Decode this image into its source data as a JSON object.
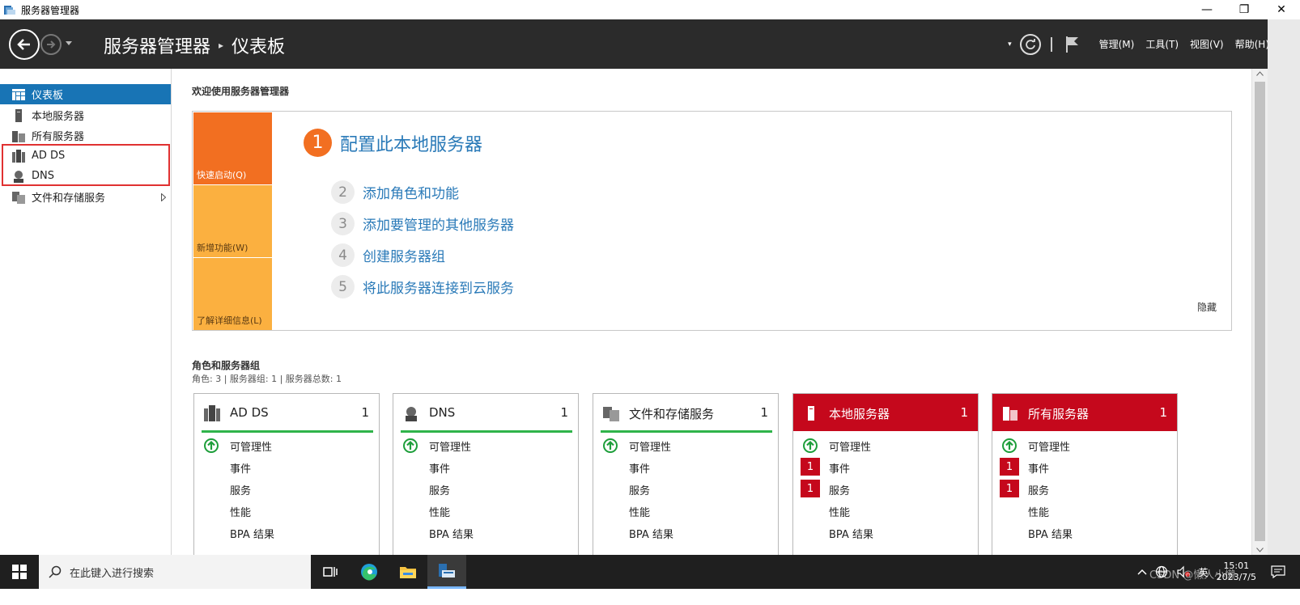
{
  "window": {
    "title": "服务器管理器",
    "minimize": "—",
    "maximize": "❐",
    "close": "✕"
  },
  "header": {
    "breadcrumb_root": "服务器管理器",
    "breadcrumb_sep": "▸",
    "breadcrumb_page": "仪表板",
    "dropdown": "▾",
    "menus": [
      "管理(M)",
      "工具(T)",
      "视图(V)",
      "帮助(H)"
    ]
  },
  "sidebar": {
    "items": [
      {
        "label": "仪表板",
        "icon": "dashboard-icon",
        "active": true
      },
      {
        "label": "本地服务器",
        "icon": "server-icon"
      },
      {
        "label": "所有服务器",
        "icon": "servers-icon"
      },
      {
        "label": "AD DS",
        "icon": "adds-icon"
      },
      {
        "label": "DNS",
        "icon": "dns-icon"
      },
      {
        "label": "文件和存储服务",
        "icon": "file-storage-icon"
      }
    ]
  },
  "quickstart": {
    "welcome": "欢迎使用服务器管理器",
    "tabs": [
      "快速启动(Q)",
      "新增功能(W)",
      "了解详细信息(L)"
    ],
    "step1": {
      "num": "1",
      "label": "配置此本地服务器"
    },
    "steps": [
      {
        "num": "2",
        "label": "添加角色和功能"
      },
      {
        "num": "3",
        "label": "添加要管理的其他服务器"
      },
      {
        "num": "4",
        "label": "创建服务器组"
      },
      {
        "num": "5",
        "label": "将此服务器连接到云服务"
      }
    ],
    "hide": "隐藏"
  },
  "roles": {
    "title": "角色和服务器组",
    "subtitle": "角色: 3 | 服务器组: 1 | 服务器总数: 1",
    "rows": [
      "可管理性",
      "事件",
      "服务",
      "性能",
      "BPA 结果"
    ],
    "tiles": [
      {
        "name": "AD DS",
        "count": "1",
        "alert": false,
        "events_badge": "",
        "services_badge": ""
      },
      {
        "name": "DNS",
        "count": "1",
        "alert": false,
        "events_badge": "",
        "services_badge": ""
      },
      {
        "name": "文件和存储服务",
        "count": "1",
        "alert": false,
        "events_badge": "",
        "services_badge": ""
      },
      {
        "name": "本地服务器",
        "count": "1",
        "alert": true,
        "events_badge": "1",
        "services_badge": "1"
      },
      {
        "name": "所有服务器",
        "count": "1",
        "alert": true,
        "events_badge": "1",
        "services_badge": "1"
      }
    ]
  },
  "taskbar": {
    "search_placeholder": "在此键入进行搜索",
    "ime": "英",
    "time": "15:01",
    "date": "2023/7/5",
    "watermark": "CSDN @懒人小懒"
  },
  "colors": {
    "accent": "#1874b5",
    "orange": "#f26f21",
    "amber": "#fbb040",
    "alert_red": "#c5081c",
    "ok_green": "#2fb44a",
    "highlight_red": "#e03131"
  }
}
